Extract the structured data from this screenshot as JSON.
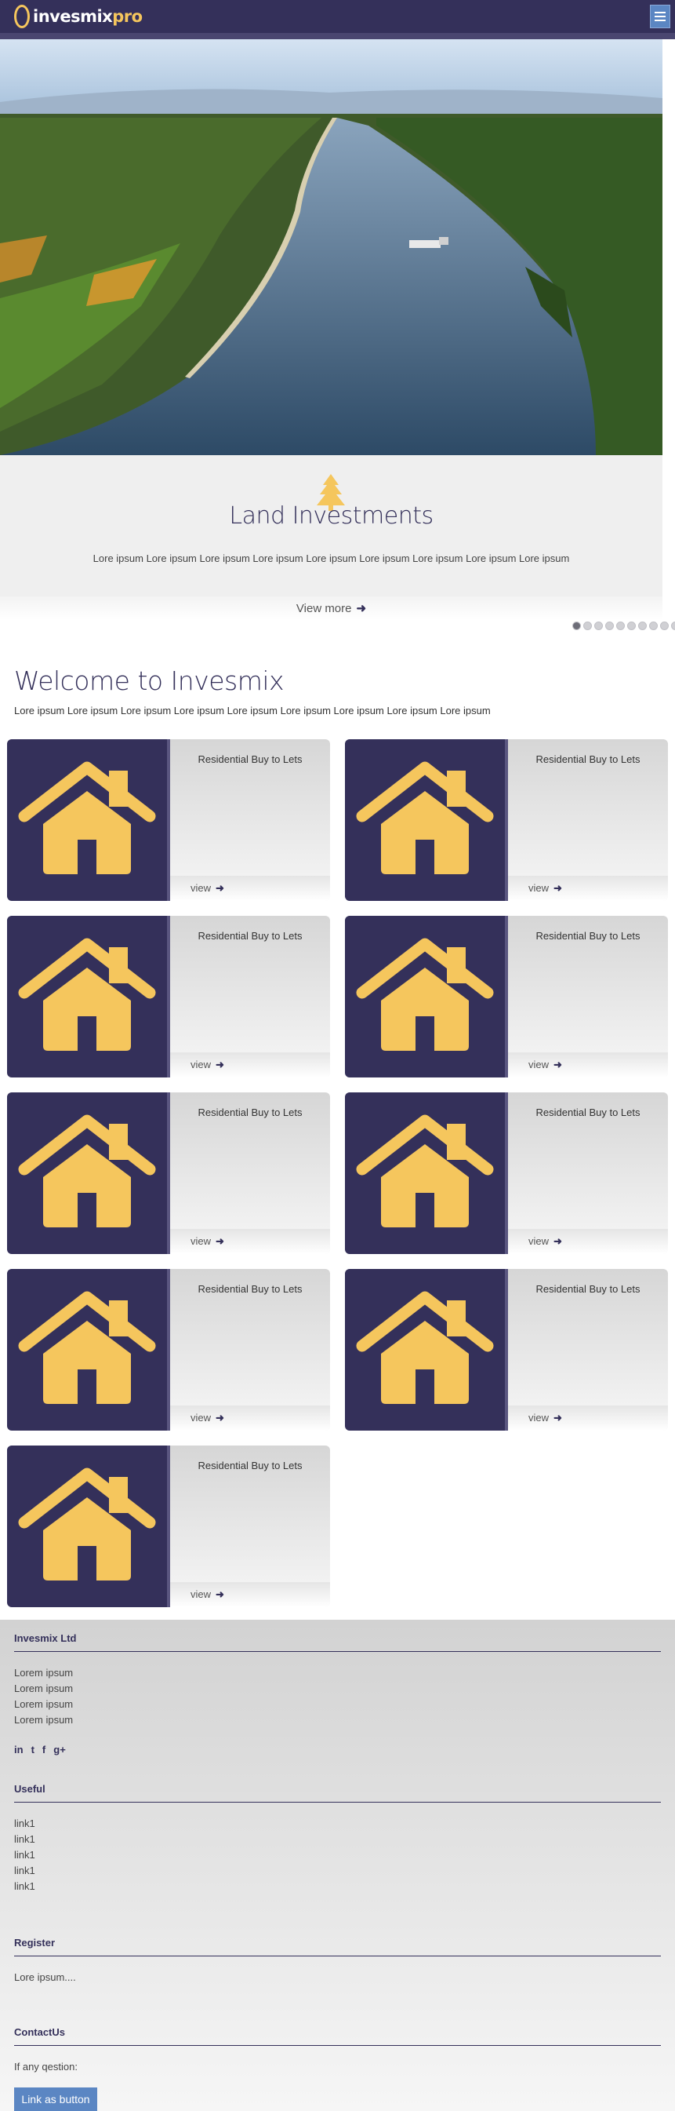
{
  "header": {
    "logo_main": "invesmix",
    "logo_accent": "pro"
  },
  "slider": {
    "title": "Land Investments",
    "text": "Lore ipsum Lore ipsum Lore ipsum Lore ipsum Lore ipsum Lore ipsum Lore ipsum Lore ipsum Lore ipsum",
    "view_more": "View more",
    "dot_count": 10,
    "active_dot": 0
  },
  "welcome": {
    "title": "Welcome to Invesmix",
    "text": "Lore ipsum Lore ipsum Lore ipsum Lore ipsum Lore ipsum Lore ipsum Lore ipsum Lore ipsum Lore ipsum"
  },
  "cards": [
    {
      "title": "Residential Buy to Lets",
      "link": "view"
    },
    {
      "title": "Residential Buy to Lets",
      "link": "view"
    },
    {
      "title": "Residential Buy to Lets",
      "link": "view"
    },
    {
      "title": "Residential Buy to Lets",
      "link": "view"
    },
    {
      "title": "Residential Buy to Lets",
      "link": "view"
    },
    {
      "title": "Residential Buy to Lets",
      "link": "view"
    },
    {
      "title": "Residential Buy to Lets",
      "link": "view"
    },
    {
      "title": "Residential Buy to Lets",
      "link": "view"
    },
    {
      "title": "Residential Buy to Lets",
      "link": "view"
    }
  ],
  "footer": {
    "company": {
      "heading": "Invesmix Ltd",
      "lines": [
        "Lorem ipsum",
        "Lorem ipsum",
        "Lorem ipsum",
        "Lorem ipsum"
      ],
      "social": [
        "in",
        "t",
        "f",
        "g+"
      ]
    },
    "useful": {
      "heading": "Useful",
      "links": [
        "link1",
        "link1",
        "link1",
        "link1",
        "link1"
      ]
    },
    "register": {
      "heading": "Register",
      "text": "Lore ipsum...."
    },
    "contact": {
      "heading": "ContactUs",
      "text": "If any qestion:",
      "button": "Link as button"
    }
  },
  "colors": {
    "brand": "#34305a",
    "accent": "#f5c65d",
    "button": "#5b86c3"
  }
}
